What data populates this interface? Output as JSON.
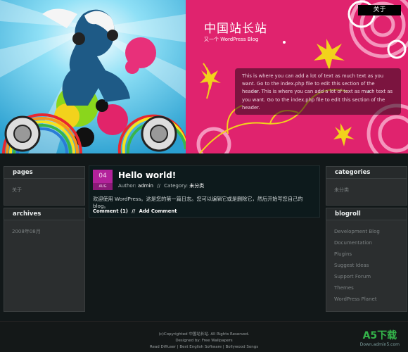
{
  "header": {
    "nav_label": "关于",
    "site_title": "中国站长站",
    "tagline": "又一个 WordPress Blog",
    "box_text": "This is where you can add a lot of text as much text as you want. Go to the index.php file to edit this section of the header. This is where you can add a lot of text as much text as you want. Go to the index.php file to edit this section of the header."
  },
  "left_sidebar": {
    "pages_title": "pages",
    "pages": [
      "关于"
    ],
    "archives_title": "archives",
    "archives": [
      "2008年08月"
    ]
  },
  "post": {
    "day": "04",
    "month": "AUG",
    "title": "Hello world!",
    "author_label": "Author:",
    "author": "admin",
    "separator": "//",
    "category_label": "Category:",
    "category": "未分类",
    "body": "欢迎使用 WordPress。这是您的第一篇日志。您可以编辑它或是删除它，然后开始写您自己的 blog。",
    "comment": "Comment (1)",
    "add_comment": "Add Comment"
  },
  "right_sidebar": {
    "categories_title": "categories",
    "categories": [
      "未分类"
    ],
    "blogroll_title": "blogroll",
    "blogroll": [
      "Development Blog",
      "Documentation",
      "Plugins",
      "Suggest Ideas",
      "Support Forum",
      "Themes",
      "WordPress Planet"
    ]
  },
  "footer": {
    "line1": "(c)Copyrighted 中国站长站. All Rights Reserved.",
    "line2": "Designed by: Free Wallpapers",
    "line3": "Read Diffuser | Best English Software | Bollywood Songs"
  },
  "watermark": {
    "main": "A5下载",
    "sub": "Down.admin5.com"
  },
  "colors": {
    "accent_pink": "#e0236e",
    "accent_cyan": "#4ec3e8",
    "date_badge": "#b3229b",
    "watermark_green": "#34b34a"
  }
}
